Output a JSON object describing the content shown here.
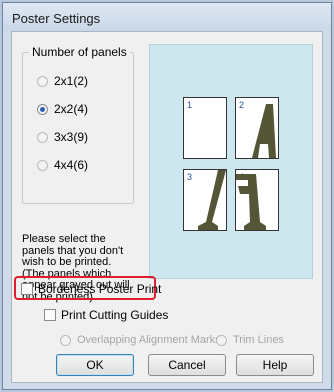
{
  "window": {
    "title": "Poster Settings"
  },
  "panels_group": {
    "label": "Number of panels",
    "options": [
      {
        "label": "2x1(2)",
        "selected": false
      },
      {
        "label": "2x2(4)",
        "selected": true
      },
      {
        "label": "3x3(9)",
        "selected": false
      },
      {
        "label": "4x4(6)",
        "selected": false
      }
    ]
  },
  "description": "Please select the panels that you don't wish to be printed. (The panels which appear grayed out will not be printed)",
  "preview": {
    "panels": [
      "1",
      "2",
      "3",
      "4"
    ]
  },
  "options": {
    "borderless_label": "Borderless Poster Print",
    "cutting_guides_label": "Print Cutting Guides",
    "overlap_label": "Overlapping Alignment Marks",
    "trim_label": "Trim Lines"
  },
  "buttons": {
    "ok": "OK",
    "cancel": "Cancel",
    "help": "Help"
  },
  "colors": {
    "highlight": "#e01f2d",
    "preview_bg": "#cce7ee",
    "letter": "#555537"
  }
}
